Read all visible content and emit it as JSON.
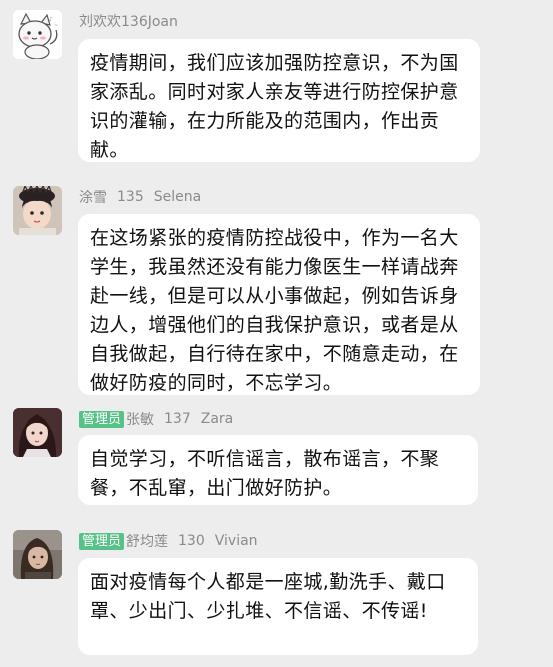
{
  "messages": [
    {
      "name": "刘欢欢136Joan",
      "is_admin": false,
      "admin_label": "",
      "level": "",
      "english_name": "",
      "text": "疫情期间，我们应该加强防控意识，不为国家添乱。同时对家人亲友等进行防控保护意识的灌输，在力所能及的范围内，作出贡献。",
      "avatar_icon": "cartoon-cat-avatar"
    },
    {
      "name": "涂雪",
      "is_admin": false,
      "admin_label": "",
      "level": "135",
      "english_name": "Selena",
      "text": "在这场紧张的疫情防控战役中，作为一名大学生，我虽然还没有能力像医生一样请战奔赴一线，但是可以从小事做起，例如告诉身边人，增强他们的自我保护意识，或者是从自我做起，自行待在家中，不随意走动，在做好防疫的同时，不忘学习。",
      "avatar_icon": "girl-photo-avatar"
    },
    {
      "name": "张敏",
      "is_admin": true,
      "admin_label": "管理员",
      "level": "137",
      "english_name": "Zara",
      "text": "自觉学习，不听信谣言，散布谣言，不聚餐，不乱窜，出门做好防护。",
      "avatar_icon": "illustrated-girl-avatar"
    },
    {
      "name": "舒均莲",
      "is_admin": true,
      "admin_label": "管理员",
      "level": "130",
      "english_name": "Vivian",
      "text": "面对疫情每个人都是一座城,勤洗手、戴口罩、少出门、少扎堆、不信谣、不传谣!",
      "avatar_icon": "woman-photo-avatar"
    }
  ]
}
